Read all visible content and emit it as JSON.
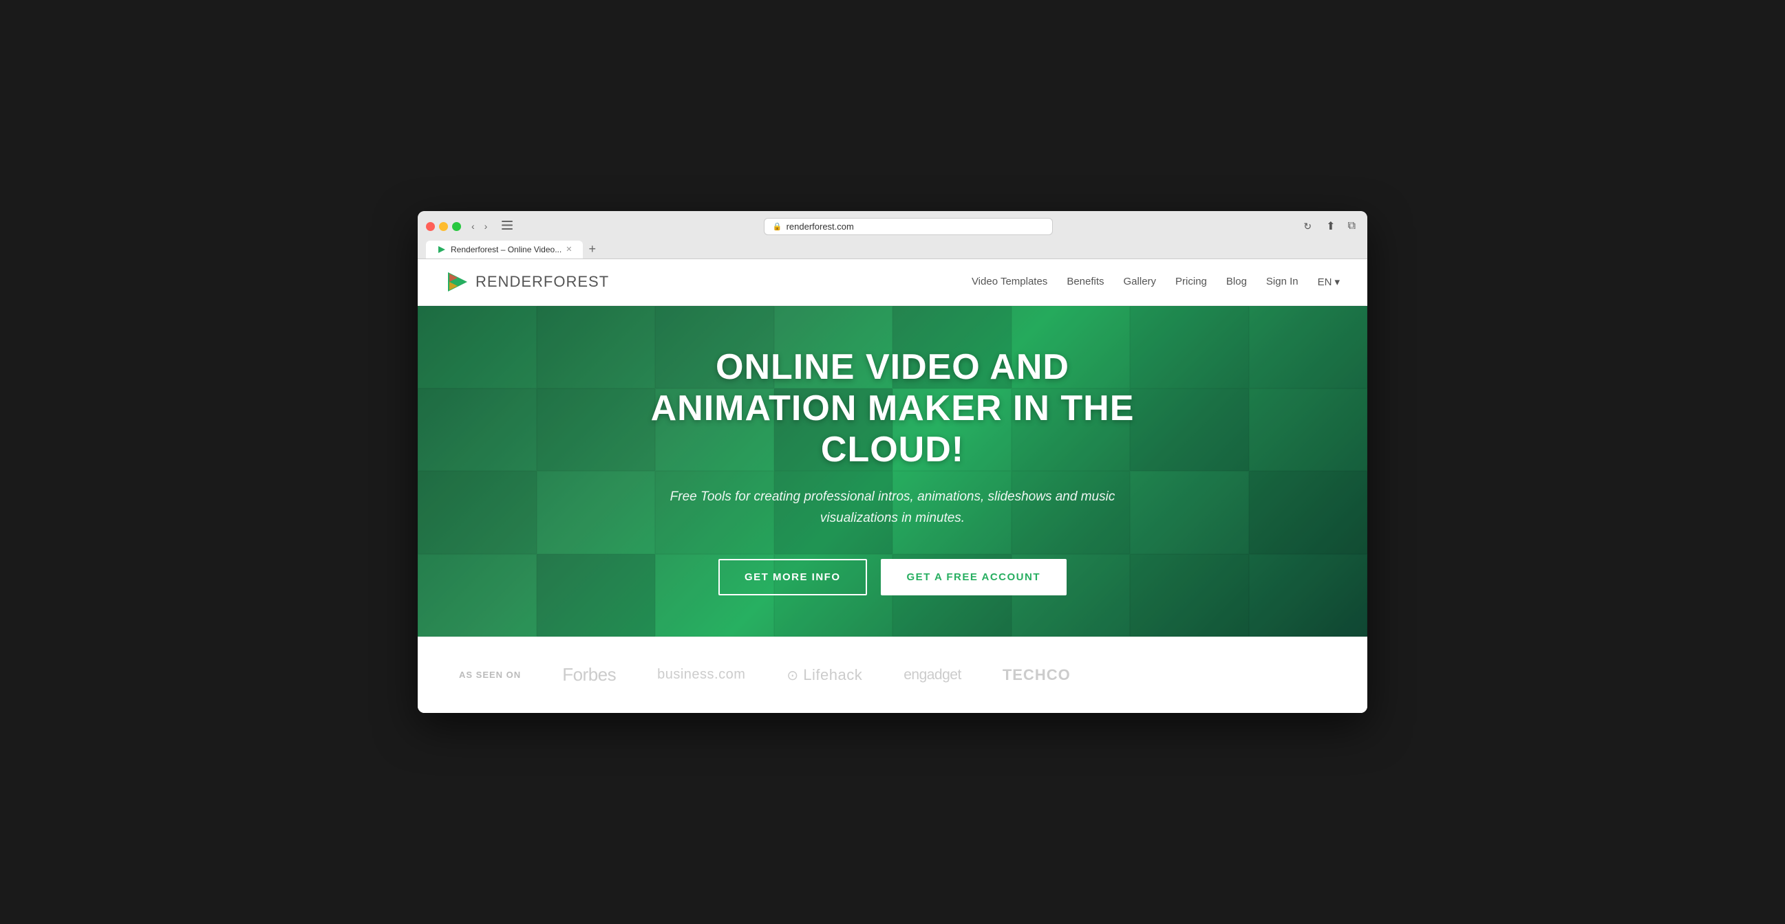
{
  "browser": {
    "url": "renderforest.com",
    "tab_label": "Renderforest – Online Video...",
    "back_btn": "‹",
    "forward_btn": "›",
    "refresh_btn": "↻",
    "share_btn": "⬆",
    "new_tab_btn": "＋"
  },
  "nav": {
    "logo_text_bold": "RENDER",
    "logo_text_light": "FOREST",
    "links": [
      {
        "label": "Video Templates",
        "href": "#"
      },
      {
        "label": "Benefits",
        "href": "#"
      },
      {
        "label": "Gallery",
        "href": "#"
      },
      {
        "label": "Pricing",
        "href": "#"
      },
      {
        "label": "Blog",
        "href": "#"
      },
      {
        "label": "Sign In",
        "href": "#"
      }
    ],
    "lang": "EN"
  },
  "hero": {
    "title": "ONLINE VIDEO AND ANIMATION MAKER IN THE CLOUD!",
    "subtitle": "Free Tools for creating professional intros, animations, slideshows and music visualizations in minutes.",
    "btn_info": "GET MORE INFO",
    "btn_account": "GET A FREE ACCOUNT"
  },
  "as_seen_on": {
    "label": "AS SEEN ON",
    "logos": [
      {
        "name": "Forbes",
        "class": "forbes"
      },
      {
        "name": "business.com",
        "class": "business"
      },
      {
        "name": "⊙ Lifehack",
        "class": "lifehack"
      },
      {
        "name": "engadget",
        "class": "engadget"
      },
      {
        "name": "TECHCO",
        "class": "techco"
      }
    ]
  }
}
